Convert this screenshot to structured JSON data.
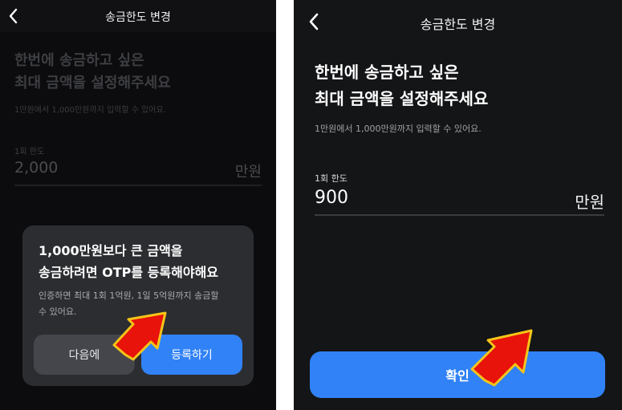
{
  "colors": {
    "accent": "#3182f6",
    "arrow_fill": "#e8130b",
    "arrow_outline": "#f5c518"
  },
  "left_screen": {
    "header": {
      "back_icon": "chevron-left-icon",
      "title": "송금한도 변경"
    },
    "heading_line1": "한번에 송금하고 싶은",
    "heading_line2": "최대 금액을 설정해주세요",
    "subtext": "1만원에서 1,000만원까지 입력할 수 있어요.",
    "field_label": "1회 한도",
    "amount_value": "2,000",
    "amount_unit": "만원",
    "dialog": {
      "title_line1": "1,000만원보다 큰 금액을",
      "title_line2": "송금하려면 OTP를 등록해야해요",
      "body_line1": "인증하면 최대 1회 1억원, 1일 5억원까지 송금할",
      "body_line2": "수 있어요.",
      "later_label": "다음에",
      "register_label": "등록하기"
    }
  },
  "right_screen": {
    "header": {
      "back_icon": "chevron-left-icon",
      "title": "송금한도 변경"
    },
    "heading_line1": "한번에 송금하고 싶은",
    "heading_line2": "최대 금액을 설정해주세요",
    "subtext": "1만원에서 1,000만원까지 입력할 수 있어요.",
    "field_label": "1회 한도",
    "amount_value": "900",
    "amount_unit": "만원",
    "confirm_label": "확인"
  }
}
